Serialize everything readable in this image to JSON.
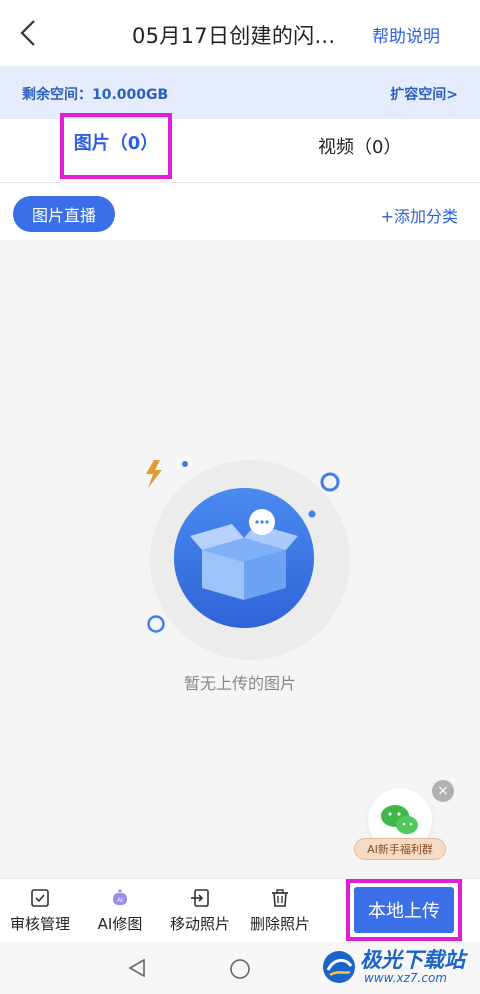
{
  "header": {
    "title": "05月17日创建的闪...",
    "help_label": "帮助说明"
  },
  "space": {
    "remaining_label": "剩余空间：10.000GB",
    "expand_label": "扩容空间>"
  },
  "tabs": [
    {
      "label": "图片（0）",
      "active": true
    },
    {
      "label": "视频（0）",
      "active": false
    }
  ],
  "filter": {
    "chip_label": "图片直播",
    "add_category_label": "+添加分类"
  },
  "empty": {
    "text": "暂无上传的图片"
  },
  "float": {
    "wechat_label": "AI新手福利群"
  },
  "bottom": {
    "items": [
      {
        "label": "审核管理",
        "icon": "check-box-icon"
      },
      {
        "label": "AI修图",
        "icon": "ai-robot-icon"
      },
      {
        "label": "移动照片",
        "icon": "move-icon"
      },
      {
        "label": "删除照片",
        "icon": "trash-icon"
      }
    ],
    "upload_label": "本地上传"
  },
  "watermark": {
    "name": "极光下载站",
    "url": "www.xz7.com"
  },
  "colors": {
    "accent": "#3a6fe8",
    "highlight": "#e21ed8",
    "space_bg": "#e5ecfb"
  }
}
